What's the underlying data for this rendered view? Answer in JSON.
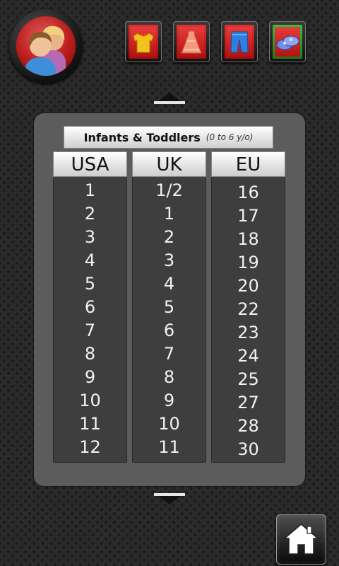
{
  "header": {
    "profile_icon": "parents-icon",
    "categories": [
      {
        "icon": "shirt-icon",
        "active": false
      },
      {
        "icon": "dress-icon",
        "active": false
      },
      {
        "icon": "pants-icon",
        "active": false
      },
      {
        "icon": "shoes-icon",
        "active": true
      }
    ]
  },
  "table": {
    "title": "Infants & Toddlers",
    "subtitle": "(0 to 6 y/o)",
    "columns": [
      {
        "header": "USA",
        "values": [
          "1",
          "2",
          "3",
          "4",
          "5",
          "6",
          "7",
          "8",
          "9",
          "10",
          "11",
          "12"
        ]
      },
      {
        "header": "UK",
        "values": [
          "1/2",
          "1",
          "2",
          "3",
          "4",
          "5",
          "6",
          "7",
          "8",
          "9",
          "10",
          "11"
        ]
      },
      {
        "header": "EU",
        "values": [
          "16",
          "17",
          "18",
          "19",
          "20",
          "22",
          "23",
          "24",
          "25",
          "27",
          "28",
          "30"
        ]
      }
    ]
  },
  "nav": {
    "up_icon": "chevron-up-icon",
    "down_icon": "chevron-down-icon",
    "home_icon": "home-icon"
  },
  "colors": {
    "active": "#2fa82f",
    "inactive": "#c81818",
    "panel": "#5c5c5c"
  }
}
